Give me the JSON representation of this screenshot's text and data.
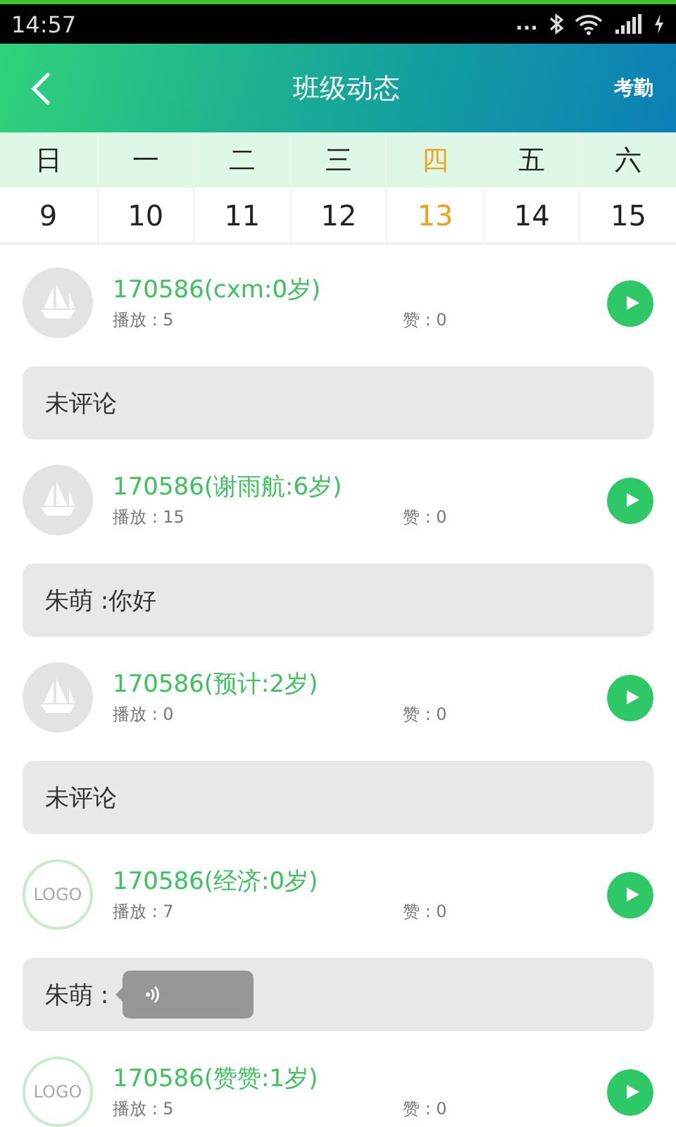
{
  "status_bar": {
    "time": "14:57",
    "dots": "..."
  },
  "header": {
    "title": "班级动态",
    "action": "考勤"
  },
  "week": [
    {
      "day": "日",
      "date": "9",
      "selected": false
    },
    {
      "day": "一",
      "date": "10",
      "selected": false
    },
    {
      "day": "二",
      "date": "11",
      "selected": false
    },
    {
      "day": "三",
      "date": "12",
      "selected": false
    },
    {
      "day": "四",
      "date": "13",
      "selected": true
    },
    {
      "day": "五",
      "date": "14",
      "selected": false
    },
    {
      "day": "六",
      "date": "15",
      "selected": false
    }
  ],
  "posts": [
    {
      "avatar": {
        "kind": "ship"
      },
      "title": "170586(cxm:0岁)",
      "plays": "播放 : 5",
      "likes": "赞 : 0",
      "comment": {
        "kind": "text",
        "text": "未评论"
      }
    },
    {
      "avatar": {
        "kind": "ship"
      },
      "title": "170586(谢雨航:6岁)",
      "plays": "播放 : 15",
      "likes": "赞 : 0",
      "comment": {
        "kind": "text",
        "text": "朱萌 :你好"
      }
    },
    {
      "avatar": {
        "kind": "ship"
      },
      "title": "170586(预计:2岁)",
      "plays": "播放 : 0",
      "likes": "赞 : 0",
      "comment": {
        "kind": "text",
        "text": "未评论"
      }
    },
    {
      "avatar": {
        "kind": "logo",
        "text": "LOGO"
      },
      "title": "170586(经济:0岁)",
      "plays": "播放 : 7",
      "likes": "赞 : 0",
      "comment": {
        "kind": "voice",
        "text": "朱萌 :"
      }
    },
    {
      "avatar": {
        "kind": "logo",
        "text": "LOGO"
      },
      "title": "170586(赞赞:1岁)",
      "plays": "播放 : 5",
      "likes": "赞 : 0"
    }
  ]
}
